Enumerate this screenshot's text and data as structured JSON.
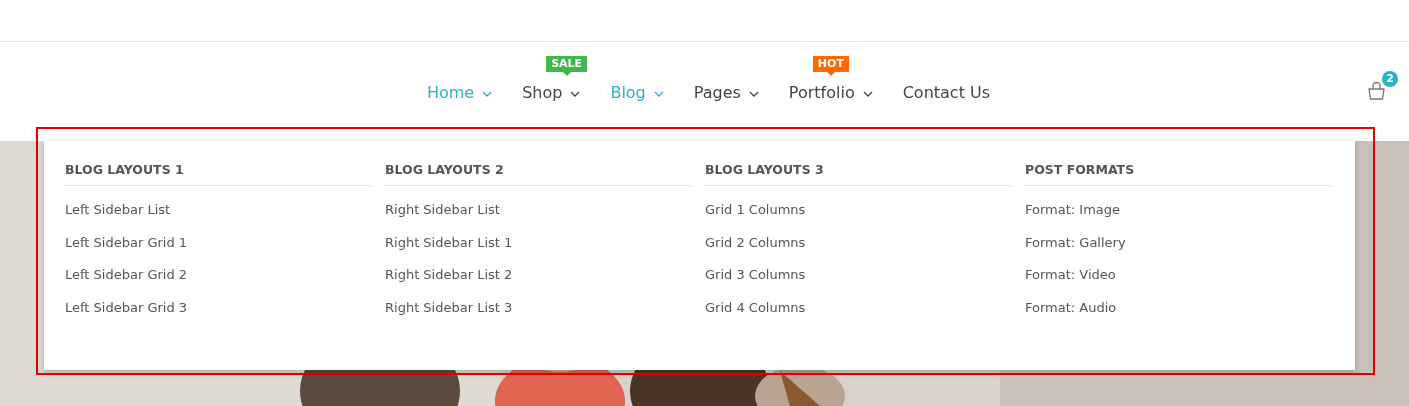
{
  "nav": [
    {
      "label": "Home",
      "selected": true,
      "caret": true
    },
    {
      "label": "Shop",
      "selected": false,
      "caret": true,
      "badge": {
        "text": "SALE",
        "color": "#3cb94b"
      }
    },
    {
      "label": "Blog",
      "selected": true,
      "caret": true
    },
    {
      "label": "Pages",
      "selected": false,
      "caret": true
    },
    {
      "label": "Portfolio",
      "selected": false,
      "caret": true,
      "badge": {
        "text": "HOT",
        "color": "#ff6a00"
      }
    },
    {
      "label": "Contact Us",
      "selected": false,
      "caret": false
    }
  ],
  "cart": {
    "count": "2"
  },
  "mega_menu": {
    "columns": [
      {
        "heading": "BLOG LAYOUTS 1",
        "items": [
          "Left Sidebar List",
          "Left Sidebar Grid 1",
          "Left Sidebar Grid 2",
          "Left Sidebar Grid 3"
        ]
      },
      {
        "heading": "BLOG LAYOUTS 2",
        "items": [
          "Right Sidebar List",
          "Right Sidebar List 1",
          "Right Sidebar List 2",
          "Right Sidebar List 3"
        ]
      },
      {
        "heading": "BLOG LAYOUTS 3",
        "items": [
          "Grid 1 Columns",
          "Grid 2 Columns",
          "Grid 3 Columns",
          "Grid 4 Columns"
        ]
      },
      {
        "heading": "POST FORMATS",
        "items": [
          "Format: Image",
          "Format: Gallery",
          "Format: Video",
          "Format: Audio"
        ]
      }
    ]
  }
}
